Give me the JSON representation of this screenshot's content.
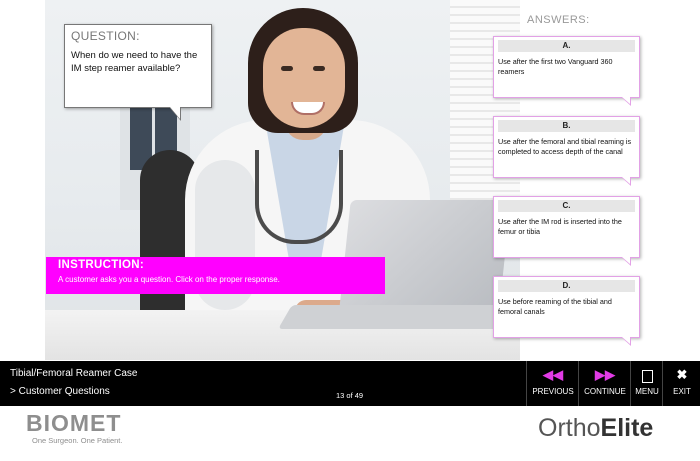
{
  "question": {
    "title": "QUESTION:",
    "text": "When do we need to have the IM step reamer available?"
  },
  "instruction": {
    "title": "INSTRUCTION:",
    "text": "A customer asks you a question. Click on the proper response."
  },
  "answers": {
    "title": "ANSWERS:",
    "items": [
      {
        "letter": "A.",
        "text": "Use after the first two Vanguard 360 reamers"
      },
      {
        "letter": "B.",
        "text": "Use after the femoral and tibial reaming is completed to access depth of the canal"
      },
      {
        "letter": "C.",
        "text": "Use after the IM rod is inserted into the femur or tibia"
      },
      {
        "letter": "D.",
        "text": "Use before reaming of the tibial and femoral canals"
      }
    ]
  },
  "navbar": {
    "course_title": "Tibial/Femoral Reamer Case",
    "section": "> Customer Questions",
    "pager": "13 of 49",
    "previous_label": "PREVIOUS",
    "continue_label": "CONTINUE",
    "menu_label": "MENU",
    "exit_label": "EXIT",
    "previous_icon": "double-chevron-left-icon",
    "continue_icon": "double-chevron-right-icon",
    "menu_icon": "document-icon",
    "exit_icon": "close-icon",
    "accent_color": "#e23be6"
  },
  "footer": {
    "brand": "BIOMET",
    "tagline": "One Surgeon. One Patient.",
    "product_prefix": "Ortho",
    "product_suffix": "Elite"
  },
  "colors": {
    "instruction_bg": "#ff00ff",
    "answer_border": "#e2a1e6",
    "navbar_bg": "#000000"
  }
}
